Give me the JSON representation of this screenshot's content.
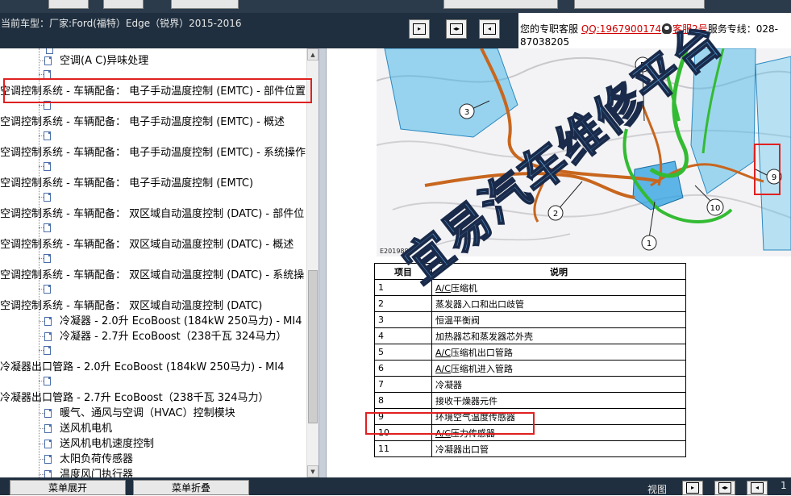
{
  "header": {
    "car_model": "当前车型：厂家:Ford(福特）Edge（锐界）2015-2016",
    "service": {
      "prefix": "您的专职客服",
      "qq": "QQ:1967900174",
      "agent": "客服2号",
      "hotline_label": "服务专线：028-",
      "hotline_rest": "87038205"
    }
  },
  "tree": {
    "rows": [
      {
        "text": "空调(A C)异味处理"
      },
      {
        "text": "空调控制系统 - 车辆配备： 电子手动温度控制 (EMTC) - 部件位置"
      },
      {
        "text": "空调控制系统 - 车辆配备： 电子手动温度控制 (EMTC) - 概述"
      },
      {
        "text": "空调控制系统 - 车辆配备： 电子手动温度控制 (EMTC) - 系统操作"
      },
      {
        "text": "空调控制系统 - 车辆配备： 电子手动温度控制 (EMTC)"
      },
      {
        "text": "空调控制系统 - 车辆配备： 双区域自动温度控制 (DATC) - 部件位"
      },
      {
        "text": "空调控制系统 - 车辆配备： 双区域自动温度控制 (DATC) - 概述"
      },
      {
        "text": "空调控制系统 - 车辆配备： 双区域自动温度控制 (DATC) - 系统操"
      },
      {
        "text": "空调控制系统 - 车辆配备： 双区域自动温度控制 (DATC)"
      },
      {
        "text": "冷凝器 - 2.0升 EcoBoost (184kW 250马力) - MI4"
      },
      {
        "text": "冷凝器 - 2.7升 EcoBoost（238千瓦 324马力）"
      },
      {
        "text": "冷凝器出口管路 - 2.0升 EcoBoost (184kW 250马力) - MI4"
      },
      {
        "text": "冷凝器出口管路 - 2.7升 EcoBoost（238千瓦 324马力）"
      },
      {
        "text": "暖气、通风与空调（HVAC）控制模块"
      },
      {
        "text": "送风机电机"
      },
      {
        "text": "送风机电机速度控制"
      },
      {
        "text": "太阳负荷传感器"
      },
      {
        "text": "温度风门执行器"
      }
    ]
  },
  "diagram": {
    "code": "E201988",
    "callouts": [
      "1",
      "2",
      "3",
      "5",
      "9",
      "10"
    ]
  },
  "parts_table": {
    "headers": [
      "项目",
      "说明"
    ],
    "rows": [
      {
        "item": "1",
        "desc_prefix": "A/C",
        "desc": "压缩机"
      },
      {
        "item": "2",
        "desc_prefix": "",
        "desc": "蒸发器入口和出口歧管"
      },
      {
        "item": "3",
        "desc_prefix": "",
        "desc": "恒温平衡阀"
      },
      {
        "item": "4",
        "desc_prefix": "",
        "desc": "加热器芯和蒸发器芯外壳"
      },
      {
        "item": "5",
        "desc_prefix": "A/C",
        "desc": "压缩机出口管路"
      },
      {
        "item": "6",
        "desc_prefix": "A/C",
        "desc": "压缩机进入管路"
      },
      {
        "item": "7",
        "desc_prefix": "",
        "desc": "冷凝器"
      },
      {
        "item": "8",
        "desc_prefix": "",
        "desc": "接收干燥器元件"
      },
      {
        "item": "9",
        "desc_prefix": "",
        "desc": "环境空气温度传感器"
      },
      {
        "item": "10",
        "desc_prefix": "A/C",
        "desc": "压力传感器"
      },
      {
        "item": "11",
        "desc_prefix": "",
        "desc": "冷凝器出口管"
      }
    ]
  },
  "watermark": "宜易汽车维修平台",
  "footer": {
    "expand_label": "菜单展开",
    "collapse_label": "菜单折叠",
    "view_label": "视图",
    "page": "1"
  },
  "colors": {
    "header_bg": "#1f2f3f",
    "highlight_red": "#e02020",
    "link_red": "#d00000",
    "pipe_orange": "#c8661e",
    "pipe_green": "#33bb33",
    "part_blue": "#4ab8e8"
  }
}
